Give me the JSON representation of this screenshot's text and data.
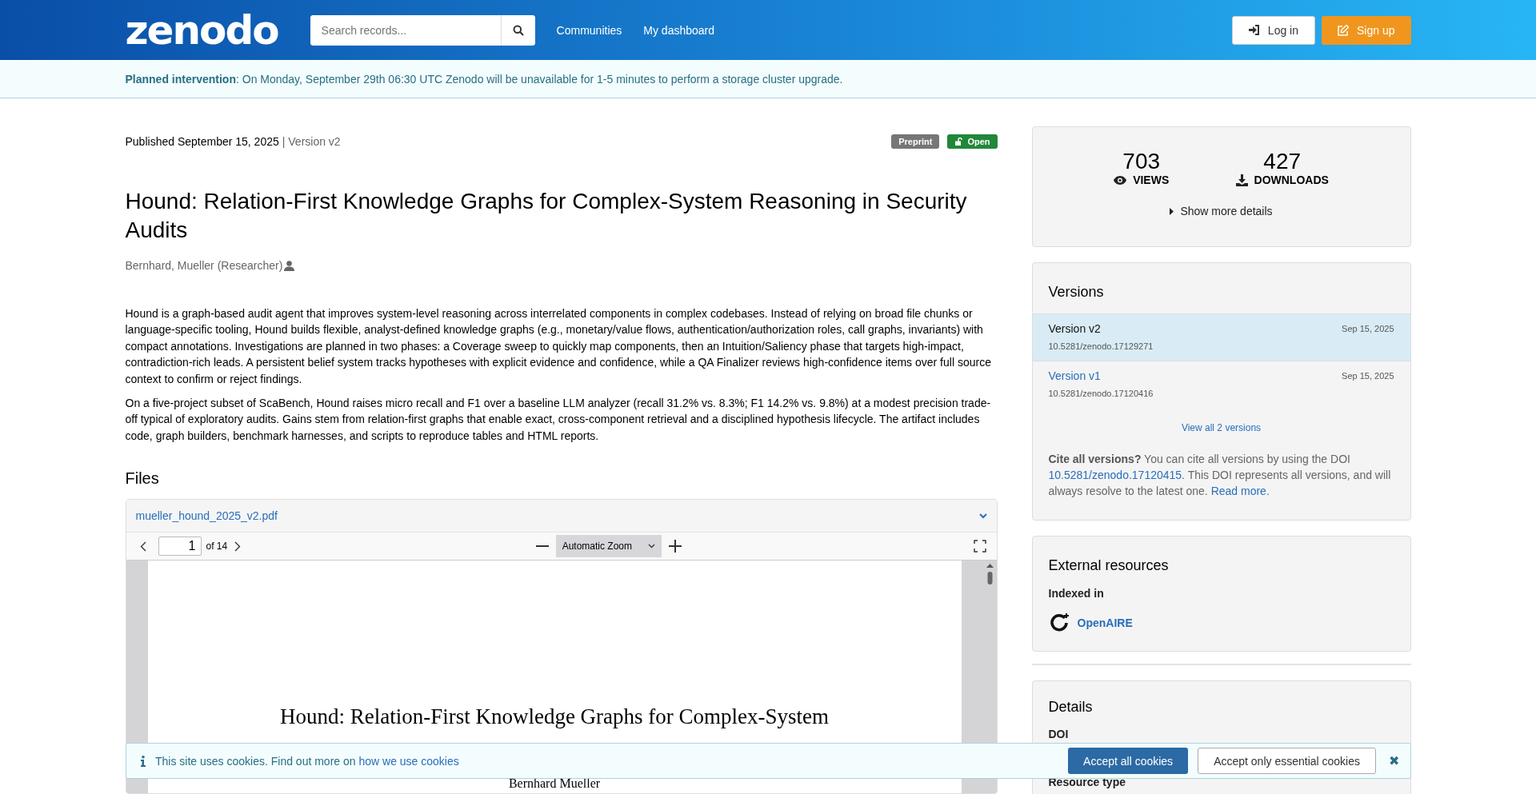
{
  "header": {
    "logo": "zenodo",
    "search": {
      "placeholder": "Search records..."
    },
    "nav": [
      "Communities",
      "My dashboard"
    ],
    "login": "Log in",
    "signup": "Sign up"
  },
  "banner": {
    "title": "Planned intervention",
    "text": ": On Monday, September 29th 06:30 UTC Zenodo will be unavailable for 1-5 minutes to perform a storage cluster upgrade."
  },
  "record": {
    "published": "Published September 15, 2025",
    "version": "| Version v2",
    "badges": [
      {
        "label": "Preprint",
        "kind": "type"
      },
      {
        "label": "Open",
        "kind": "access"
      }
    ],
    "title": "Hound: Relation-First Knowledge Graphs for Complex-System Reasoning in Security Audits",
    "author": "Bernhard, Mueller (Researcher)",
    "abstract": [
      "Hound is a graph-based audit agent that improves system-level reasoning across interrelated components in complex codebases. Instead of relying on broad file chunks or language-specific tooling, Hound builds flexible, analyst-defined knowledge graphs (e.g., monetary/value flows, authentication/authorization roles, call graphs, invariants) with compact annotations. Investigations are planned in two phases: a Coverage sweep to quickly map components, then an Intuition/Saliency phase that targets high-impact, contradiction-rich leads. A persistent belief system tracks hypotheses with explicit evidence and confidence, while a QA Finalizer reviews high-confidence items over full source context to confirm or reject findings.",
      "On a five-project subset of ScaBench, Hound raises micro recall and F1 over a baseline LLM analyzer (recall 31.2% vs. 8.3%; F1 14.2% vs. 9.8%) at a modest precision trade-off typical of exploratory audits. Gains stem from relation-first graphs that enable exact, cross-component retrieval and a disciplined hypothesis lifecycle. The artifact includes code, graph builders, benchmark harnesses, and scripts to reproduce tables and HTML reports."
    ]
  },
  "files": {
    "heading": "Files",
    "filename": "mueller_hound_2025_v2.pdf",
    "page": "1",
    "page_count": "of 14",
    "zoom": "Automatic Zoom",
    "pdf_title": "Hound: Relation-First Knowledge Graphs for Complex-System",
    "pdf_author": "Bernhard Mueller"
  },
  "stats": [
    {
      "value": "703",
      "label": "VIEWS",
      "kind": "views"
    },
    {
      "value": "427",
      "label": "DOWNLOADS",
      "kind": "downloads"
    }
  ],
  "show_more": "Show more details",
  "versions": {
    "heading": "Versions",
    "items": [
      {
        "label": "Version v2",
        "date": "Sep 15, 2025",
        "doi": "10.5281/zenodo.17129271",
        "selected": true
      },
      {
        "label": "Version v1",
        "date": "Sep 15, 2025",
        "doi": "10.5281/zenodo.17120416",
        "selected": false
      }
    ],
    "view_all": "View all 2 versions",
    "cite": "**Cite all versions?** You can cite all versions by using the DOI",
    "cite_doi": "10.5281/zenodo.17120415",
    "cite_rest": ". This DOI represents all versions, and will always resolve to the latest one.",
    "read_more": "Read more",
    "cite_end": "."
  },
  "external": {
    "heading": "External resources",
    "indexed": "Indexed in",
    "source": "OpenAIRE"
  },
  "details": {
    "heading": "Details",
    "fields": [
      "DOI",
      "Resource type"
    ]
  },
  "cookies": {
    "text": "This site uses cookies. Find out more on",
    "link": "how we use cookies",
    "accept_all": "Accept all cookies",
    "accept_essential": "Accept only essential cookies",
    "close": "✖"
  }
}
